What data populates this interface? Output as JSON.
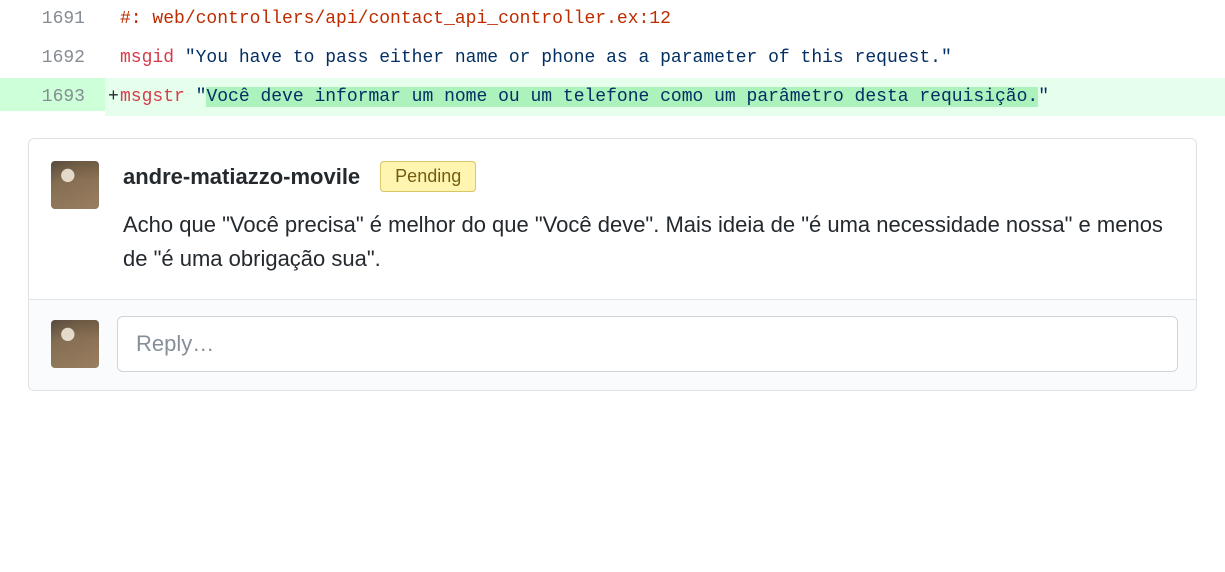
{
  "diff": {
    "lines": [
      {
        "num": "1691",
        "kind": "normal",
        "marker": "",
        "segments": [
          {
            "cls": "tok-red",
            "text": "#:"
          },
          {
            "cls": "",
            "text": " "
          },
          {
            "cls": "tok-path",
            "text": "web/controllers/api/contact_api_controller.ex:12"
          }
        ]
      },
      {
        "num": "1692",
        "kind": "normal",
        "marker": "",
        "segments": [
          {
            "cls": "tok-key",
            "text": "msgid"
          },
          {
            "cls": "",
            "text": " "
          },
          {
            "cls": "tok-str",
            "text": "\"You have to pass either name or phone as a parameter of this request.\""
          }
        ]
      },
      {
        "num": "1693",
        "kind": "added",
        "marker": "+",
        "segments": [
          {
            "cls": "tok-key",
            "text": "msgstr"
          },
          {
            "cls": "",
            "text": " "
          },
          {
            "cls": "tok-str",
            "text": "\""
          },
          {
            "cls": "tok-str tok-added-mark",
            "text": "Você deve informar um nome ou um telefone como um parâmetro desta requisição."
          },
          {
            "cls": "tok-str",
            "text": "\""
          }
        ]
      }
    ]
  },
  "comment": {
    "author": "andre-matiazzo-movile",
    "badge": "Pending",
    "text": "Acho que \"Você precisa\" é melhor do que \"Você deve\". Mais ideia de \"é uma necessidade nossa\" e menos de \"é uma obrigação sua\"."
  },
  "reply": {
    "placeholder": "Reply…"
  }
}
